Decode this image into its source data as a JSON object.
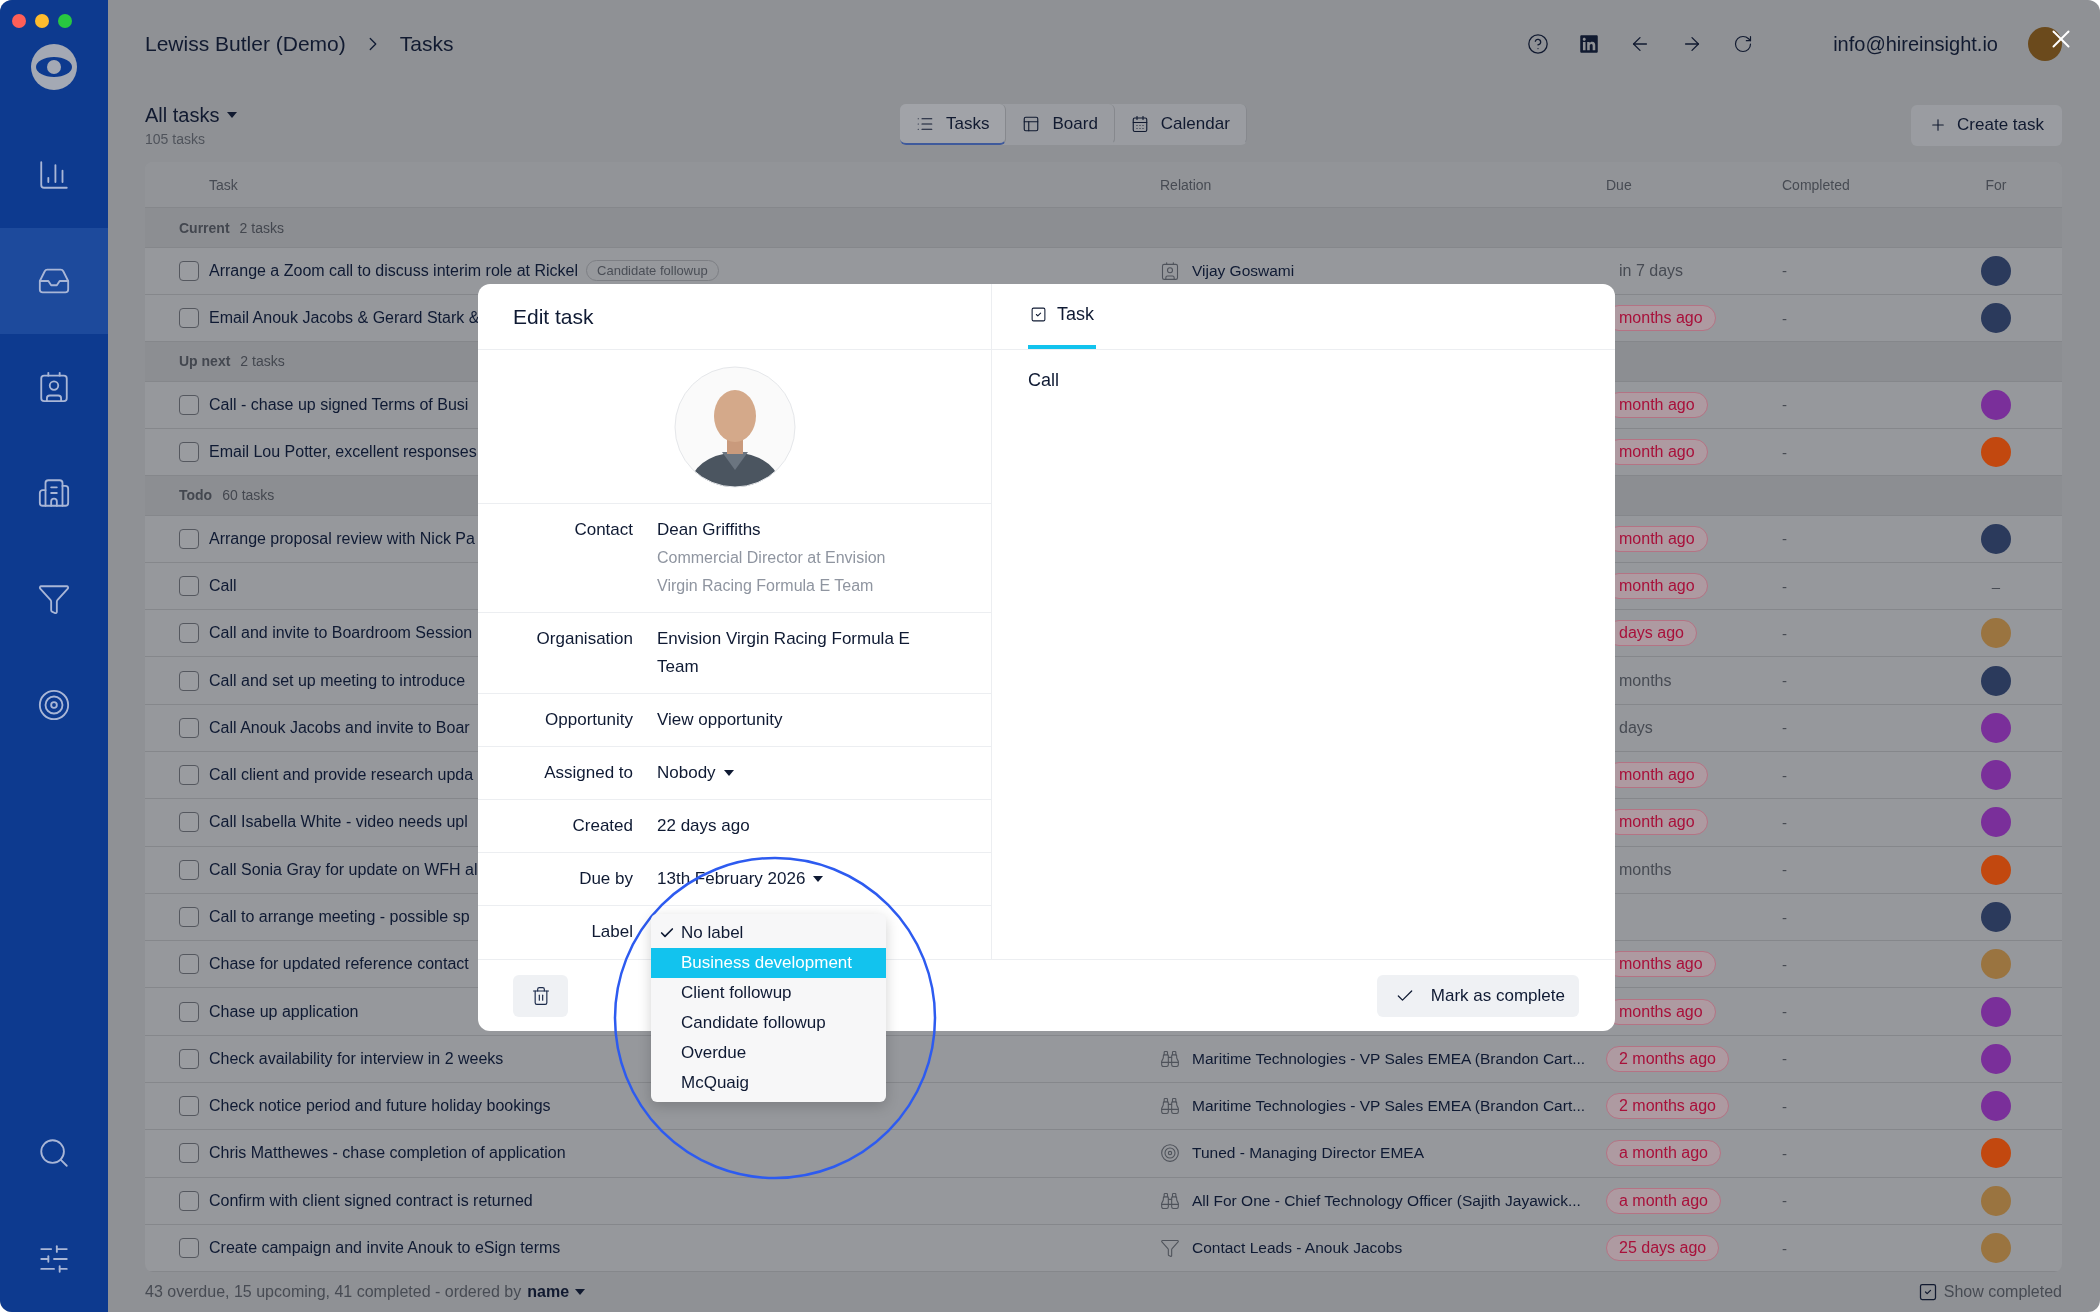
{
  "sidebar": {
    "items": [
      {
        "selected": false
      },
      {
        "selected": true
      },
      {
        "selected": false
      },
      {
        "selected": false
      },
      {
        "selected": false
      },
      {
        "selected": false
      }
    ],
    "bottom_items": [
      {
        "selected": false
      },
      {
        "selected": false
      }
    ]
  },
  "header": {
    "breadcrumb": [
      "Lewiss Butler (Demo)",
      "Tasks"
    ],
    "account_email": "info@hireinsight.io"
  },
  "toolbar": {
    "view_filter": "All tasks",
    "task_count": "105 tasks",
    "views": [
      {
        "label": "Tasks",
        "selected": true
      },
      {
        "label": "Board",
        "selected": false
      },
      {
        "label": "Calendar",
        "selected": false
      }
    ],
    "create_button": "Create task"
  },
  "table": {
    "columns": [
      "Task",
      "Relation",
      "Due",
      "Completed",
      "For"
    ],
    "groups": [
      {
        "name": "Current",
        "count": "2 tasks",
        "rows": [
          {
            "task": "Arrange a Zoom call to discuss interim role at Rickel",
            "checked": false,
            "tag": "Candidate followup",
            "relation": {
              "kind": "contact",
              "name": "Vijay Goswami"
            },
            "due": "in 7 days",
            "overdue": false,
            "completed": "-",
            "color": "#2b3a5c"
          },
          {
            "task": "Email Anouk Jacobs & Gerard Stark &",
            "checked": false,
            "due": "months ago",
            "overdue": true,
            "completed": "-",
            "color": "#2b3a5c"
          }
        ]
      },
      {
        "name": "Up next",
        "count": "2 tasks",
        "rows": [
          {
            "task": "Call - chase up signed Terms of Busi",
            "checked": false,
            "due": "month ago",
            "overdue": true,
            "completed": "-",
            "color": "#7a2f9a"
          },
          {
            "task": "Email Lou Potter, excellent responses",
            "checked": false,
            "due": "month ago",
            "overdue": true,
            "completed": "-",
            "color": "#c2480f"
          }
        ]
      },
      {
        "name": "Todo",
        "count": "60 tasks",
        "rows": [
          {
            "task": "Arrange proposal review with Nick Pa",
            "checked": false,
            "due": "month ago",
            "overdue": true,
            "completed": "-",
            "color": "#2b3a5c"
          },
          {
            "task": "Call",
            "checked": false,
            "due": "month ago",
            "overdue": true,
            "completed": "-",
            "for_text": "–"
          },
          {
            "task": "Call and invite to Boardroom Session",
            "checked": false,
            "due": "days ago",
            "overdue": true,
            "completed": "-",
            "color": "#9a7440"
          },
          {
            "task": "Call and set up meeting to introduce",
            "checked": false,
            "due": "months",
            "overdue": false,
            "completed": "-",
            "color": "#2b3a5c"
          },
          {
            "task": "Call Anouk Jacobs and invite to Boar",
            "checked": false,
            "due": "days",
            "overdue": false,
            "completed": "-",
            "color": "#7a2f9a"
          },
          {
            "task": "Call client and provide research upda",
            "checked": false,
            "due": "month ago",
            "overdue": true,
            "completed": "-",
            "color": "#7a2f9a"
          },
          {
            "task": "Call Isabella White - video needs upl",
            "checked": false,
            "due": "month ago",
            "overdue": true,
            "completed": "-",
            "color": "#7a2f9a"
          },
          {
            "task": "Call Sonia Gray for update on WFH al",
            "checked": false,
            "due": "months",
            "overdue": false,
            "completed": "-",
            "color": "#c2480f"
          },
          {
            "task": "Call to arrange meeting - possible sp",
            "checked": false,
            "completed": "-",
            "color": "#2b3a5c"
          },
          {
            "task": "Chase for updated reference contact",
            "checked": false,
            "due": "months ago",
            "overdue": true,
            "completed": "-",
            "color": "#9a7440"
          },
          {
            "task": "Chase up application",
            "checked": false,
            "due": "months ago",
            "overdue": true,
            "completed": "-",
            "color": "#7a2f9a"
          },
          {
            "task": "Check availability for interview in 2 weeks",
            "checked": false,
            "relation": {
              "kind": "job",
              "name": "Maritime Technologies - VP Sales EMEA (Brandon Cart..."
            },
            "due": "2 months ago",
            "overdue": true,
            "completed": "-",
            "color": "#7a2f9a"
          },
          {
            "task": "Check notice period and future holiday bookings",
            "checked": false,
            "relation": {
              "kind": "job",
              "name": "Maritime Technologies - VP Sales EMEA (Brandon Cart..."
            },
            "due": "2 months ago",
            "overdue": true,
            "completed": "-",
            "color": "#7a2f9a"
          },
          {
            "task": "Chris Matthewes - chase completion of application",
            "checked": false,
            "relation": {
              "kind": "target",
              "name": "Tuned - Managing Director EMEA"
            },
            "due": "a month ago",
            "overdue": true,
            "completed": "-",
            "color": "#c2480f"
          },
          {
            "task": "Confirm with client signed contract is returned",
            "checked": false,
            "relation": {
              "kind": "job",
              "name": "All For One - Chief Technology Officer (Sajith Jayawick..."
            },
            "due": "a month ago",
            "overdue": true,
            "completed": "-",
            "color": "#9a7440"
          },
          {
            "task": "Create campaign and invite Anouk to eSign terms",
            "checked": false,
            "relation": {
              "kind": "funnel",
              "name": "Contact Leads - Anouk Jacobs"
            },
            "due": "25 days ago",
            "overdue": true,
            "completed": "-",
            "color": "#9a7440"
          }
        ]
      }
    ]
  },
  "footer": {
    "summary": "43 overdue, 15 upcoming, 41 completed - ordered by",
    "order_field": "name",
    "show_completed": {
      "label": "Show completed",
      "checked": true
    }
  },
  "dialog": {
    "title": "Edit task",
    "tabs": [
      {
        "label": "Task",
        "selected": true
      }
    ],
    "description": "Call",
    "fields": [
      {
        "label": "Contact",
        "value": "Dean Griffiths",
        "detail": "Commercial Director at Envision Virgin Racing Formula E Team",
        "kind": "text"
      },
      {
        "label": "Organisation",
        "value": "Envision Virgin Racing Formula E Team",
        "kind": "text"
      },
      {
        "label": "Opportunity",
        "value": "View opportunity",
        "kind": "link"
      },
      {
        "label": "Assigned to",
        "value": "Nobody",
        "kind": "dropdown"
      },
      {
        "label": "Created",
        "value": "22 days ago",
        "kind": "text"
      },
      {
        "label": "Due by",
        "value": "13th February 2026",
        "kind": "dropdown"
      },
      {
        "label": "Label",
        "kind": "menu"
      }
    ],
    "label_menu": [
      {
        "label": "No label",
        "selected": true,
        "highlighted": false
      },
      {
        "label": "Business development",
        "selected": false,
        "highlighted": true
      },
      {
        "label": "Client followup",
        "selected": false,
        "highlighted": false
      },
      {
        "label": "Candidate followup",
        "selected": false,
        "highlighted": false
      },
      {
        "label": "Overdue",
        "selected": false,
        "highlighted": false
      },
      {
        "label": "McQuaig",
        "selected": false,
        "highlighted": false
      }
    ],
    "complete_button": "Mark as complete"
  }
}
